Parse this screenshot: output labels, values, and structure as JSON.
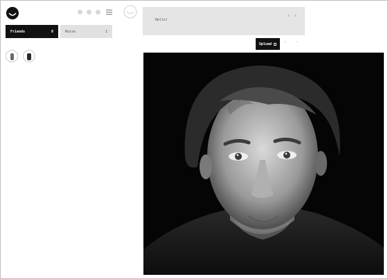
{
  "sidebar": {
    "tabs": [
      {
        "label": "Friends",
        "count": "0"
      },
      {
        "label": "Noise",
        "count": "1"
      }
    ],
    "avatars": [
      "avatar-1",
      "avatar-2"
    ]
  },
  "composer": {
    "text": "Hello!",
    "icons": "x x"
  },
  "actions": {
    "upload_label": "Upload",
    "prev": "←",
    "next": "→"
  },
  "colors": {
    "primary": "#111111",
    "tab_inactive": "#e1e1e1",
    "composer_bg": "#e5e5e5"
  },
  "icons": {
    "logo": "ello-smiley-logo",
    "header": [
      "dot-icon",
      "dot-icon",
      "dot-icon",
      "menu-icon"
    ],
    "upload": "clip-icon"
  }
}
